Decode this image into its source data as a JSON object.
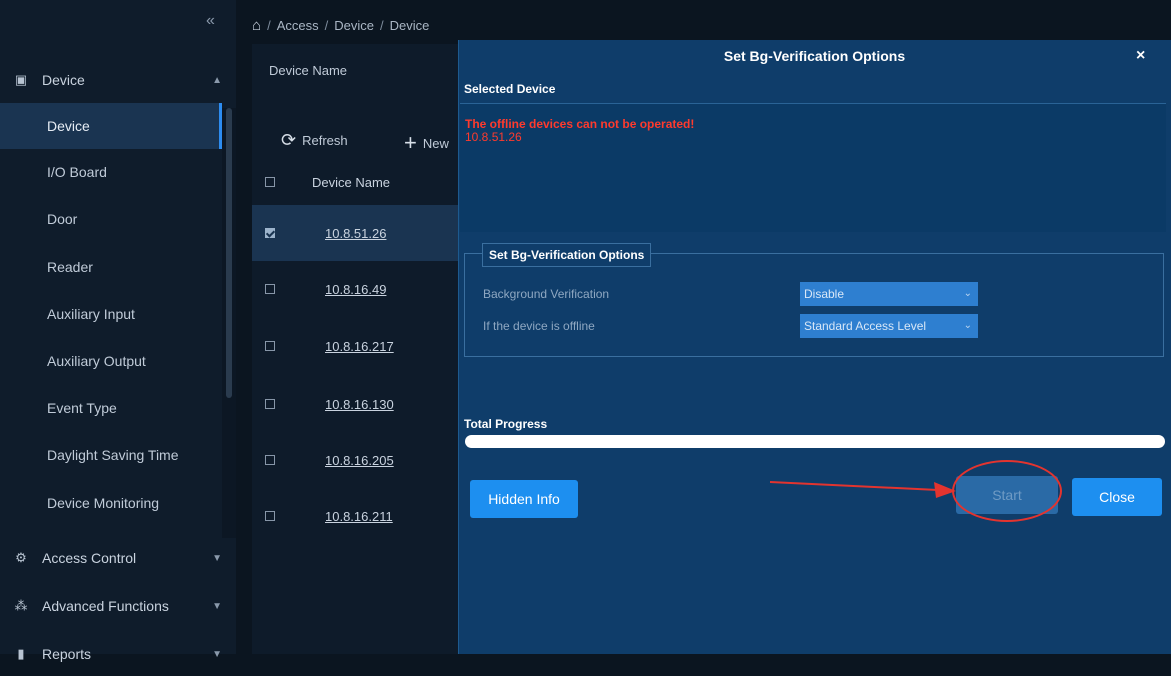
{
  "sidebar": {
    "collapse_icon": "«",
    "sections": [
      {
        "label": "Device",
        "icon": "device-icon",
        "expanded": true
      },
      {
        "label": "Access Control",
        "icon": "gear-icon",
        "expanded": false
      },
      {
        "label": "Advanced Functions",
        "icon": "advanced-icon",
        "expanded": false
      },
      {
        "label": "Reports",
        "icon": "report-icon",
        "expanded": false
      }
    ],
    "items": [
      {
        "label": "Device",
        "active": true
      },
      {
        "label": "I/O Board"
      },
      {
        "label": "Door"
      },
      {
        "label": "Reader"
      },
      {
        "label": "Auxiliary Input"
      },
      {
        "label": "Auxiliary Output"
      },
      {
        "label": "Event Type"
      },
      {
        "label": "Daylight Saving Time"
      },
      {
        "label": "Device Monitoring"
      }
    ]
  },
  "breadcrumb": {
    "home_icon": "home-icon",
    "separator": "/",
    "items": [
      "Access",
      "Device",
      "Device"
    ]
  },
  "main": {
    "filter_label": "Device Name",
    "toolbar": {
      "refresh": "Refresh",
      "new": "New"
    },
    "column_header": "Device Name",
    "rows": [
      {
        "name": "10.8.51.26",
        "checked": true
      },
      {
        "name": "10.8.16.49",
        "checked": false
      },
      {
        "name": "10.8.16.217",
        "checked": false
      },
      {
        "name": "10.8.16.130",
        "checked": false
      },
      {
        "name": "10.8.16.205",
        "checked": false
      },
      {
        "name": "10.8.16.211",
        "checked": false
      }
    ]
  },
  "modal": {
    "title": "Set Bg-Verification Options",
    "close_symbol": "×",
    "selected_device_label": "Selected Device",
    "warning": "The offline devices can not be operated!",
    "offline_device": "10.8.51.26",
    "options_legend": "Set Bg-Verification Options",
    "background_verification": {
      "label": "Background Verification",
      "value": "Disable"
    },
    "offline_behavior": {
      "label": "If the device is offline",
      "value": "Standard Access Level"
    },
    "progress_label": "Total Progress",
    "progress_fraction": 0,
    "buttons": {
      "hidden_info": "Hidden Info",
      "start": "Start",
      "close": "Close"
    }
  },
  "colors": {
    "accent": "#1d8ff0",
    "warning": "#ff3a2d",
    "annotation": "#e3342f"
  }
}
